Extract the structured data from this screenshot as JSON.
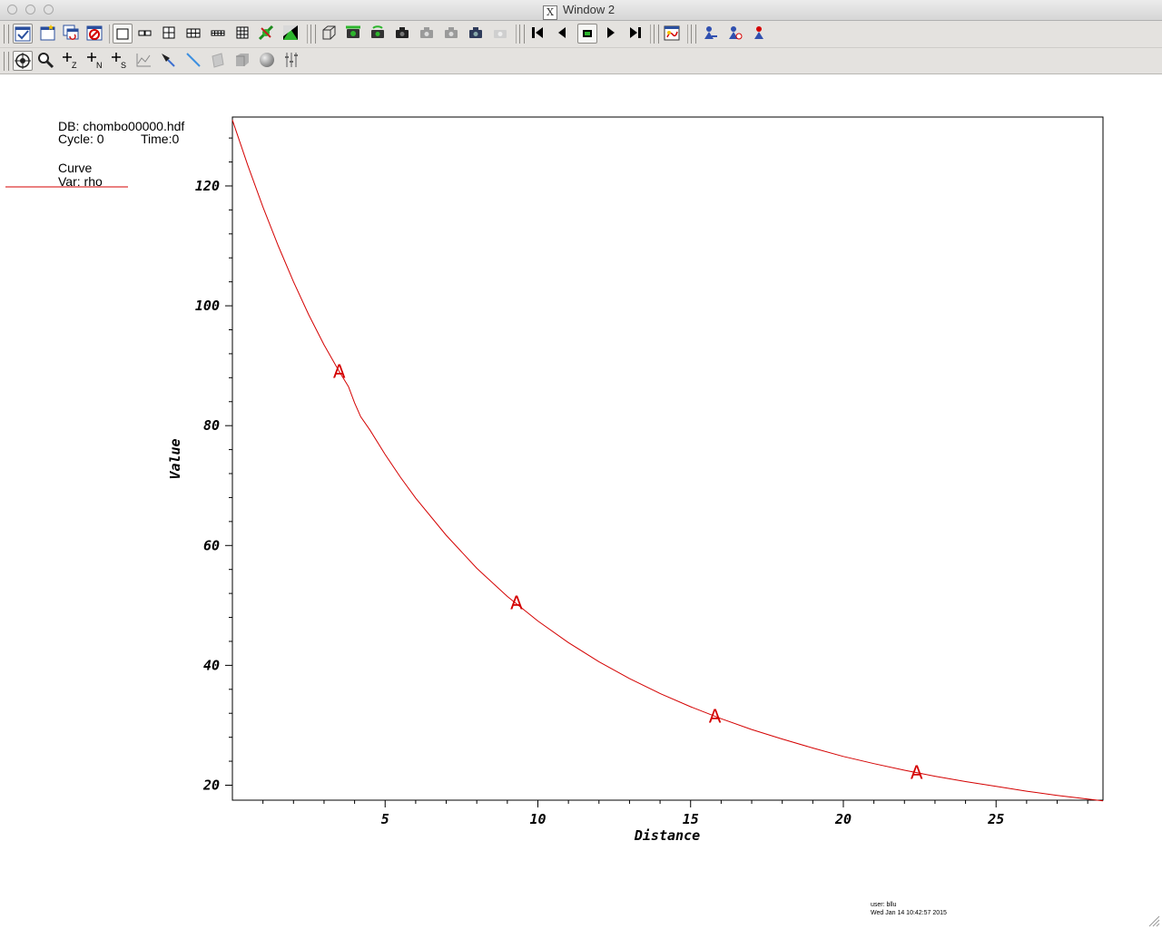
{
  "window": {
    "title": "Window 2"
  },
  "annotations": {
    "db_label": "DB: chombo00000.hdf",
    "cycle_label": "Cycle: 0",
    "time_label": "Time:0",
    "curve_label": "Curve",
    "var_label": "Var: rho",
    "user_label": "user: bllu",
    "date_label": "Wed Jan 14 10:42:57 2015"
  },
  "toolbar1": [
    "active-window-icon",
    "new-window-icon",
    "clone-window-icon",
    "delete-window-icon",
    "layout-1x1-icon",
    "layout-1x2-icon",
    "layout-2x2-icon",
    "layout-2x3-icon",
    "layout-2x4-icon",
    "layout-3x3-icon",
    "lock-view-icon",
    "lock-tools-icon",
    "invert-background-icon",
    "camera-clear-icon",
    "camera-reset-icon",
    "camera-undo-icon",
    "camera-redo-icon",
    "camera-save-icon",
    "camera-choose-icon",
    "camera-delete-icon",
    "reverse-step-icon",
    "reverse-play-icon",
    "stop-icon",
    "play-icon",
    "forward-step-icon",
    "expression-icon",
    "pick-icon",
    "lineout-icon",
    "query-icon"
  ],
  "toolbar2": [
    "navigate-icon",
    "zoom-icon",
    "zone-pick-icon",
    "node-pick-icon",
    "spreadsheet-pick-icon",
    "curve-pick-icon",
    "point-tool-icon",
    "line-tool-icon",
    "plane-tool-icon",
    "box-tool-icon",
    "sphere-tool-icon",
    "axis-restriction-icon"
  ],
  "colors": {
    "curve": "#d40000",
    "axis": "#000000",
    "background": "#ffffff",
    "toolbar": "#e4e2df"
  },
  "chart_data": {
    "type": "line",
    "xlabel": "Distance",
    "ylabel": "Value",
    "xlim": [
      0,
      28.5
    ],
    "ylim": [
      17.5,
      131.5
    ],
    "x_ticks": [
      5,
      10,
      15,
      20,
      25
    ],
    "x_tick_labels": [
      "5",
      "10",
      "15",
      "20",
      "25"
    ],
    "y_ticks": [
      20,
      40,
      60,
      80,
      100,
      120
    ],
    "y_tick_labels": [
      "20",
      "40",
      "60",
      "80",
      "100",
      "120"
    ],
    "series": [
      {
        "name": "rho",
        "marker": "A",
        "x": [
          0,
          0.5,
          1,
          1.5,
          2,
          2.5,
          3,
          3.5,
          3.8,
          4.0,
          4.2,
          4.5,
          5,
          5.5,
          6,
          7,
          8,
          9,
          10,
          11,
          12,
          13,
          14,
          15,
          16,
          17,
          18,
          19,
          20,
          21,
          22,
          23,
          24,
          25,
          26,
          27,
          28,
          28.5
        ],
        "y": [
          131,
          123.5,
          116.5,
          110,
          104,
          98.5,
          93.5,
          89,
          86.5,
          83.8,
          81.5,
          79.3,
          75.2,
          71.4,
          67.9,
          61.7,
          56.2,
          51.5,
          47.4,
          43.8,
          40.6,
          37.8,
          35.3,
          33.1,
          31.1,
          29.3,
          27.7,
          26.2,
          24.8,
          23.6,
          22.5,
          21.5,
          20.6,
          19.8,
          19.0,
          18.3,
          17.7,
          17.4
        ],
        "marker_points": [
          {
            "x": 3.5,
            "y": 89.0
          },
          {
            "x": 9.3,
            "y": 50.4
          },
          {
            "x": 15.8,
            "y": 31.5
          },
          {
            "x": 22.4,
            "y": 22.1
          }
        ]
      }
    ]
  }
}
